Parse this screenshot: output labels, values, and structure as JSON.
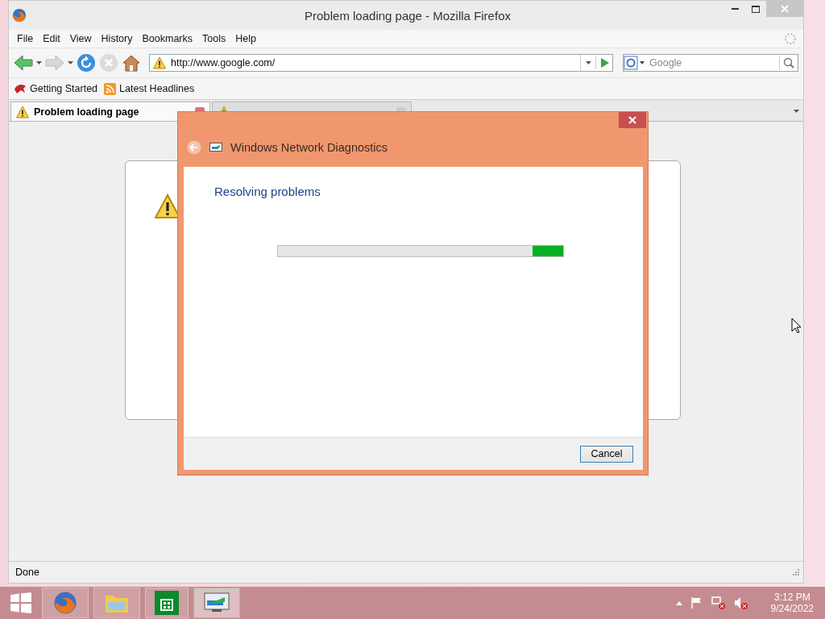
{
  "window": {
    "title": "Problem loading page - Mozilla Firefox"
  },
  "menu": [
    "File",
    "Edit",
    "View",
    "History",
    "Bookmarks",
    "Tools",
    "Help"
  ],
  "navigation": {
    "url": "http://www.google.com/",
    "search_placeholder": "Google"
  },
  "bookmarks": [
    "Getting Started",
    "Latest Headlines"
  ],
  "tabs": [
    {
      "label": "Problem loading page",
      "selected": true
    },
    {
      "selected": false
    }
  ],
  "dialog": {
    "title": "Windows Network Diagnostics",
    "heading": "Resolving problems",
    "level": 1,
    "button": "Cancel"
  },
  "status_bar": {
    "text": "Done"
  },
  "taskbar": {
    "apps": [
      {
        "kind": "firefox",
        "selected": false
      },
      {
        "kind": "folder",
        "selected": false
      },
      {
        "kind": "store",
        "selected": false
      },
      {
        "kind": "network",
        "selected": true
      }
    ],
    "time": "3:12 PM",
    "date": "9/24/2022"
  }
}
